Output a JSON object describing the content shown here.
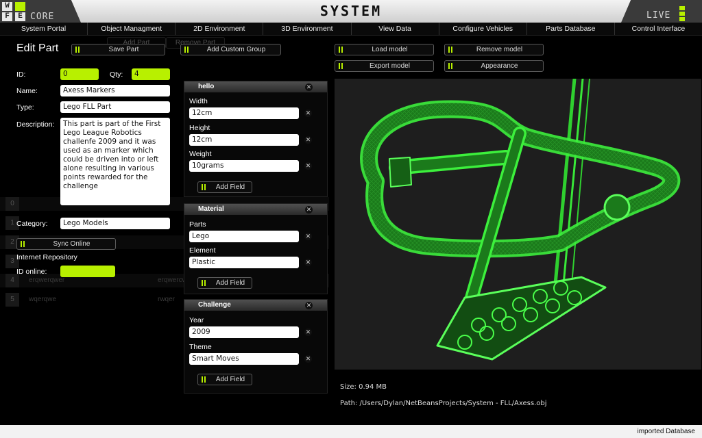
{
  "brand": {
    "left_logo": [
      "W",
      "F",
      "E"
    ],
    "core_label": "CORE",
    "title": "SYSTEM",
    "live_label": "LIVE"
  },
  "nav": {
    "tabs": [
      "System Portal",
      "Object Managment",
      "2D Environment",
      "3D Environment",
      "View Data",
      "Configure Vehicles",
      "Parts Database",
      "Control Interface"
    ]
  },
  "toolbar": {
    "page_title": "Edit Part",
    "save_part": "Save Part",
    "add_custom_group": "Add Custom Group",
    "load_model": "Load model",
    "remove_model": "Remove model",
    "export_model": "Export model",
    "appearance": "Appearance",
    "add_part_ghost": "Add Part",
    "remove_part_ghost": "Remove Part"
  },
  "form": {
    "id_label": "ID:",
    "id_value": "0",
    "qty_label": "Qty:",
    "qty_value": "4",
    "name_label": "Name:",
    "name_value": "Axess Markers",
    "type_label": "Type:",
    "type_value": "Lego FLL Part",
    "description_label": "Description:",
    "description_value": "This part is part of the First Lego League Robotics challenfe 2009 and it was used as an marker which could be driven into or left alone resulting in various points rewarded for the challenge",
    "category_label": "Category:",
    "category_value": "Lego Models",
    "sync_online": "Sync Online",
    "internet_repository": "Internet Repository",
    "id_online_label": "ID online:",
    "id_online_value": ""
  },
  "background_list": {
    "rows": [
      {
        "num": "0",
        "col1": "",
        "col2": ""
      },
      {
        "num": "1",
        "col1": "",
        "col2": ""
      },
      {
        "num": "2",
        "col1": "",
        "col2": ""
      },
      {
        "num": "3",
        "col1": "",
        "col2": ""
      },
      {
        "num": "4",
        "col1": "erqwerqwer",
        "col2": "erqwercw"
      },
      {
        "num": "5",
        "col1": "wqerqwe",
        "col2": "rwqer"
      }
    ]
  },
  "groups": [
    {
      "title": "hello",
      "fields": [
        {
          "label": "Width",
          "value": "12cm"
        },
        {
          "label": "Height",
          "value": "12cm"
        },
        {
          "label": "Weight",
          "value": "10grams"
        }
      ],
      "add_field": "Add Field"
    },
    {
      "title": "Material",
      "fields": [
        {
          "label": "Parts",
          "value": "Lego"
        },
        {
          "label": "Element",
          "value": "Plastic"
        }
      ],
      "add_field": "Add Field"
    },
    {
      "title": "Challenge",
      "fields": [
        {
          "label": "Year",
          "value": "2009"
        },
        {
          "label": "Theme",
          "value": "Smart Moves"
        }
      ],
      "add_field": "Add Field"
    }
  ],
  "viewer": {
    "size_text": "Size: 0.94 MB",
    "path_text": "Path: /Users/Dylan/NetBeansProjects/System - FLL/Axess.obj",
    "wire_color": "#44ff44"
  },
  "status": {
    "text": "imported Database"
  },
  "colors": {
    "accent": "#b8f000",
    "background": "#000000"
  }
}
